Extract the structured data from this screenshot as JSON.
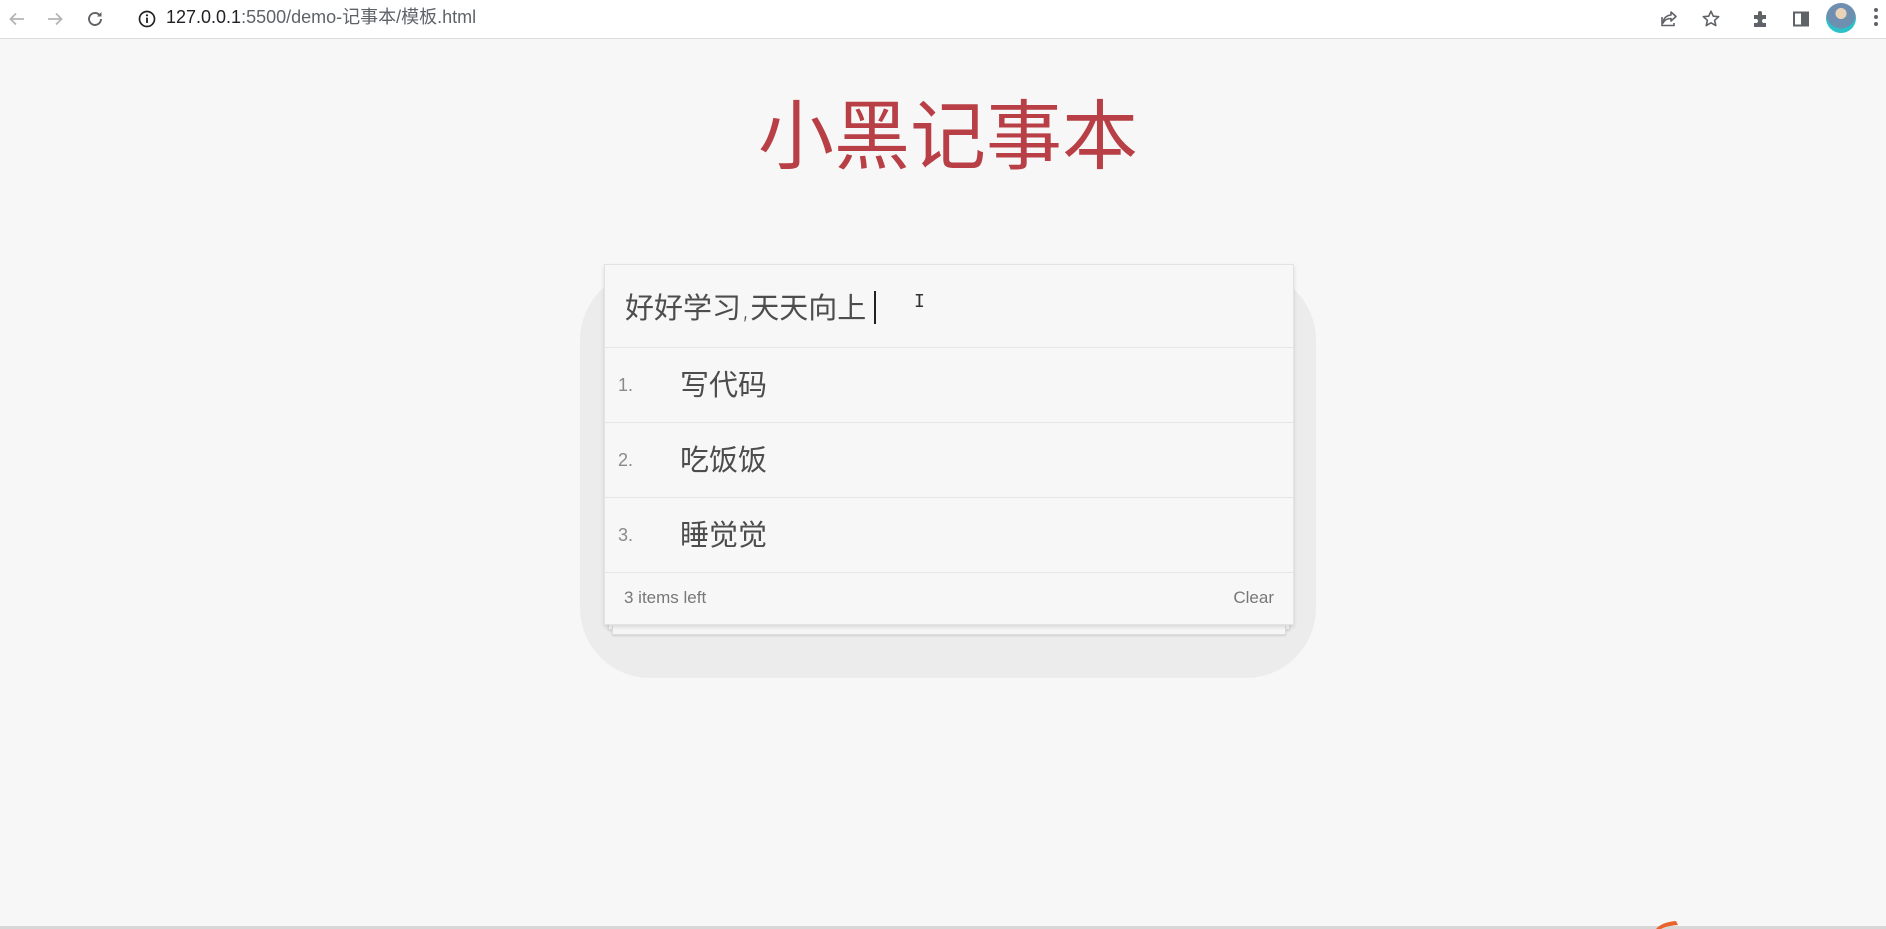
{
  "browser": {
    "url_host": "127.0.0.1",
    "url_path": ":5500/demo-记事本/模板.html"
  },
  "icons": {
    "back": "arrow-left-icon",
    "forward": "arrow-right-icon",
    "reload": "reload-icon",
    "site_info": "info-icon",
    "share": "share-icon",
    "bookmark": "star-icon",
    "extensions": "puzzle-icon",
    "side_panel": "side-panel-icon",
    "menu": "kebab-menu-icon"
  },
  "app": {
    "title": "小黑记事本",
    "input_value": "好好学习,天天向上",
    "items": [
      {
        "index": "1.",
        "label": "写代码"
      },
      {
        "index": "2.",
        "label": "吃饭饭"
      },
      {
        "index": "3.",
        "label": "睡觉觉"
      }
    ],
    "footer": {
      "count_text": "3 items left",
      "clear_label": "Clear"
    }
  },
  "colors": {
    "title": "#b83f45",
    "background": "#f7f7f7",
    "text": "#4d4d4d",
    "muted": "#777777"
  }
}
